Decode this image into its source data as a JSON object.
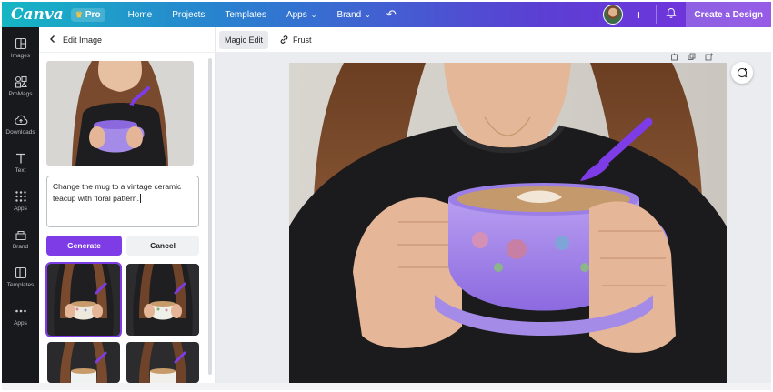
{
  "topbar": {
    "logo": "Canva",
    "pro_badge": "Pro",
    "nav": [
      "Home",
      "Projects",
      "Templates",
      "Apps",
      "Brand"
    ],
    "create_button": "Create a Design"
  },
  "sidebar": {
    "items": [
      {
        "label": "Images",
        "icon": "images-icon"
      },
      {
        "label": "ProMags",
        "icon": "promags-icon"
      },
      {
        "label": "Downloads",
        "icon": "downloads-icon"
      },
      {
        "label": "Text",
        "icon": "text-icon"
      },
      {
        "label": "Apps",
        "icon": "apps-icon"
      },
      {
        "label": "Brand",
        "icon": "brand-icon"
      },
      {
        "label": "Templates",
        "icon": "templates-icon"
      },
      {
        "label": "Apps",
        "icon": "more-apps-icon"
      }
    ]
  },
  "panel": {
    "title": "Edit Image",
    "prompt": "Change the mug to a vintage ceramic teacup with floral pattern.",
    "generate": "Generate",
    "cancel": "Cancel"
  },
  "toolbar": {
    "magic_edit": "Magic Edit",
    "frust": "Frust"
  },
  "colors": {
    "accent": "#7d3ce6",
    "sidebar_bg": "#17191c",
    "gradient_start": "#15b6c4",
    "gradient_end": "#7a2fe0"
  }
}
